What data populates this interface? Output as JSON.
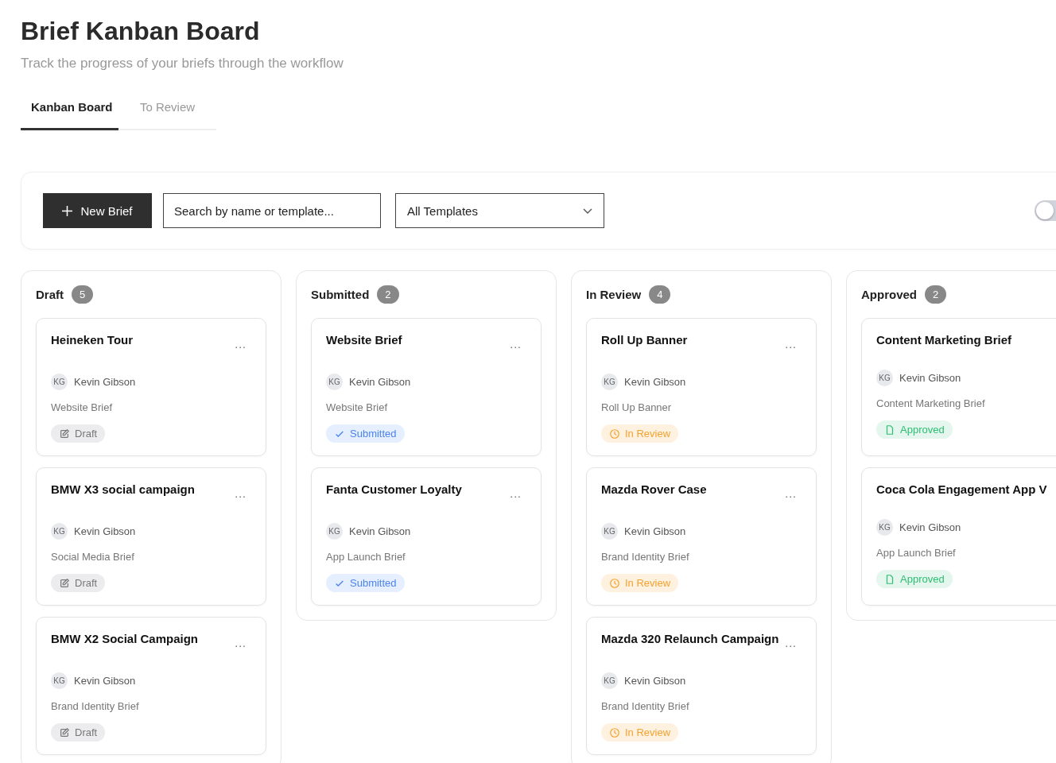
{
  "title": "Brief Kanban Board",
  "subtitle": "Track the progress of your briefs through the workflow",
  "tabs": [
    {
      "label": "Kanban Board",
      "selected": true
    },
    {
      "label": "To Review",
      "selected": false
    }
  ],
  "toolbar": {
    "new_button": "New Brief",
    "search": {
      "placeholder": "Search by name or template..."
    },
    "template_select": "All Templates",
    "toggle": {
      "on": false
    }
  },
  "columns": [
    {
      "name": "Draft",
      "count": "5",
      "cards": [
        {
          "title": "Heineken Tour",
          "owner_initials": "KG",
          "owner": "Kevin Gibson",
          "template": "Website Brief",
          "status": {
            "kind": "draft",
            "label": "Draft"
          },
          "menu": "..."
        },
        {
          "title": "BMW X3 social campaign",
          "owner_initials": "KG",
          "owner": "Kevin Gibson",
          "template": "Social Media Brief",
          "status": {
            "kind": "draft",
            "label": "Draft"
          },
          "menu": "..."
        },
        {
          "title": "BMW X2 Social Campaign",
          "owner_initials": "KG",
          "owner": "Kevin Gibson",
          "template": "Brand Identity Brief",
          "status": {
            "kind": "draft",
            "label": "Draft"
          },
          "menu": "..."
        }
      ]
    },
    {
      "name": "Submitted",
      "count": "2",
      "cards": [
        {
          "title": "Website Brief",
          "owner_initials": "KG",
          "owner": "Kevin Gibson",
          "template": "Website Brief",
          "status": {
            "kind": "submitted",
            "label": "Submitted"
          },
          "menu": "..."
        },
        {
          "title": "Fanta Customer Loyalty",
          "owner_initials": "KG",
          "owner": "Kevin Gibson",
          "template": "App Launch Brief",
          "status": {
            "kind": "submitted",
            "label": "Submitted"
          },
          "menu": "..."
        }
      ]
    },
    {
      "name": "In Review",
      "count": "4",
      "cards": [
        {
          "title": "Roll Up Banner",
          "owner_initials": "KG",
          "owner": "Kevin Gibson",
          "template": "Roll Up Banner",
          "status": {
            "kind": "in_review",
            "label": "In Review"
          },
          "menu": "..."
        },
        {
          "title": "Mazda Rover Case",
          "owner_initials": "KG",
          "owner": "Kevin Gibson",
          "template": "Brand Identity Brief",
          "status": {
            "kind": "in_review",
            "label": "In Review"
          },
          "menu": "..."
        },
        {
          "title": "Mazda 320 Relaunch Campaign",
          "owner_initials": "KG",
          "owner": "Kevin Gibson",
          "template": "Brand Identity Brief",
          "status": {
            "kind": "in_review",
            "label": "In Review"
          },
          "menu": "..."
        }
      ]
    },
    {
      "name": "Approved",
      "count": "2",
      "cards": [
        {
          "title": "Content Marketing Brief",
          "owner_initials": "KG",
          "owner": "Kevin Gibson",
          "template": "Content Marketing Brief",
          "status": {
            "kind": "approved",
            "label": "Approved"
          }
        },
        {
          "title": "Coca Cola Engagement App V",
          "owner_initials": "KG",
          "owner": "Kevin Gibson",
          "template": "App Launch Brief",
          "status": {
            "kind": "approved",
            "label": "Approved"
          }
        }
      ]
    }
  ]
}
